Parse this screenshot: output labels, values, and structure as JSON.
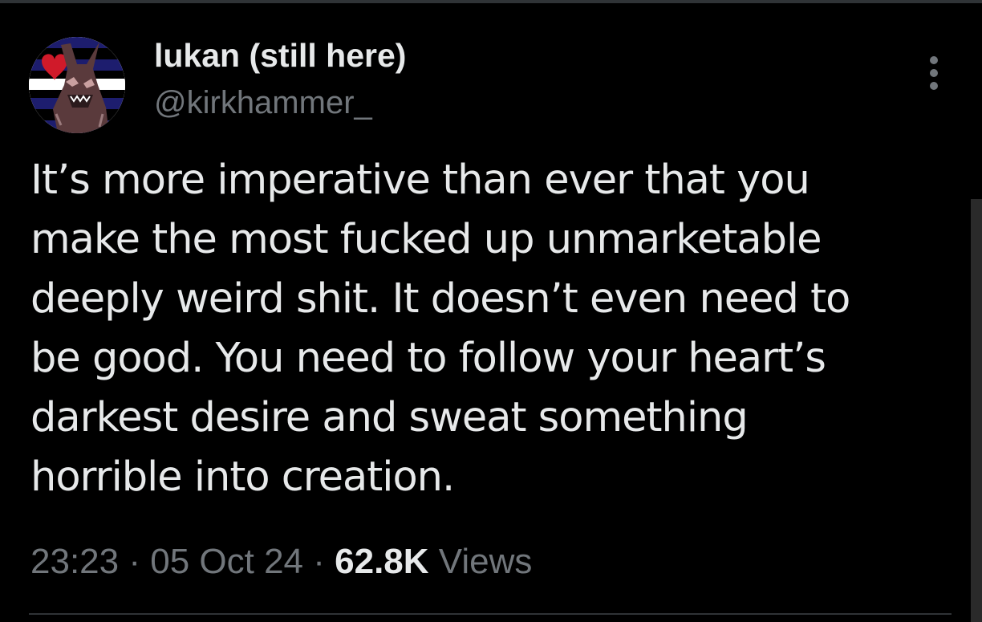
{
  "tweet": {
    "display_name": "lukan (still here)",
    "handle": "@kirkhammer_",
    "text": "It’s more imperative than ever that you\nmake the most fucked up unmarketable\ndeeply weird shit. It doesn’t even need to\nbe good. You need to follow your heart’s\ndarkest desire and sweat something\nhorrible into creation.",
    "time": "23:23",
    "separator": "·",
    "date": "05 Oct 24",
    "views_count": "62.8K",
    "views_label": "Views"
  },
  "icons": {
    "more": "more-vertical-icon",
    "avatar": "profile-avatar-image"
  },
  "colors": {
    "background": "#000000",
    "primary_text": "#e7e9ea",
    "secondary_text": "#71767b",
    "border": "#2f3336"
  }
}
